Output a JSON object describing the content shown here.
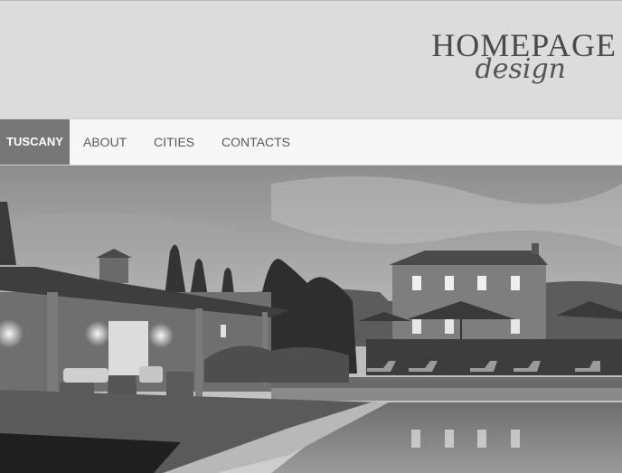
{
  "logo": {
    "main": "HOMEPAGE",
    "sub": "design"
  },
  "nav": {
    "items": [
      {
        "label": "TUSCANY",
        "active": true
      },
      {
        "label": "ABOUT",
        "active": false
      },
      {
        "label": "CITIES",
        "active": false
      },
      {
        "label": "CONTACTS",
        "active": false
      }
    ]
  },
  "colors": {
    "header_bg": "#dcdcdc",
    "nav_bg": "#f7f7f7",
    "nav_active_bg": "#777777",
    "nav_text": "#5a5a5a"
  }
}
